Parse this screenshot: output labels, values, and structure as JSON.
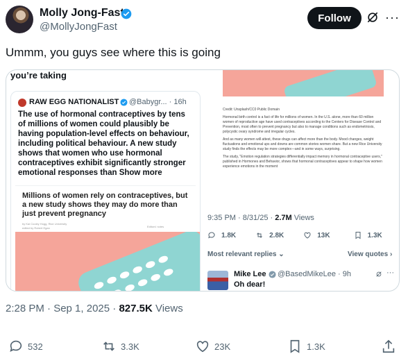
{
  "header": {
    "display_name": "Molly Jong-Fast",
    "handle": "@MollyJongFast",
    "follow_label": "Follow",
    "more_label": "···"
  },
  "tweet": {
    "text": "Ummm, you guys see where this is going",
    "timestamp": "2:28 PM · Sep 1, 2025 · ",
    "views": "827.5K",
    "views_label": " Views"
  },
  "media": {
    "top_text": "you’re taking",
    "quoted": {
      "name": "RAW EGG NATIONALIST",
      "handle": "@Babygr... · 16h",
      "text": "The use of hormonal contraceptives by tens of millions of women could plausibly be having population-level effects on behaviour, including political behaviour. A new study shows that women who use hormonal contraceptives exhibit significantly stronger emotional responses than Show more",
      "article_title": "Millions of women rely on contraceptives, but a new study shows they may do more than just prevent pregnancy",
      "byline": "by Kai Cooley Hogg, Rice University",
      "edited": "edited by Robert Egan",
      "share": "Editors' notes"
    },
    "article": {
      "credit": "Credit: Unsplash/CC0 Public Domain",
      "p1": "Hormonal birth control is a fact of life for millions of women. In the U.S. alone, more than 60 million women of reproductive age have used contraceptives according to the Centers for Disease Control and Prevention, most often to prevent pregnancy but also to manage conditions such as endometriosis, polycystic ovary syndrome and irregular cycles.",
      "p2": "And as many women will attest, these drugs can affect more than the body. Mood changes, weight fluctuations and emotional ups and downs are common stories women share. But a new Rice University study finds the effects may be more complex—and in some ways, surprising.",
      "p3": "The study, \"Emotion regulation strategies differentially impact memory in hormonal contraceptive users,\" published in Hormones and Behavior, shows that hormonal contraceptives appear to shape how women experience emotions in the moment"
    },
    "embedded_meta": {
      "time": "9:35 PM · 8/31/25 · ",
      "views": "2.7M",
      "views_label": " Views",
      "replies": "1.8K",
      "reposts": "2.8K",
      "likes": "13K",
      "bookmarks": "1.3K",
      "most_relevant": "Most relevant replies ⌄",
      "view_quotes": "View quotes ›"
    },
    "reply": {
      "name": "Mike Lee",
      "handle": "@BasedMikeLee · 9h",
      "text": "Oh dear!"
    }
  },
  "actions": {
    "replies": "532",
    "reposts": "3.3K",
    "likes": "23K",
    "bookmarks": "1.3K"
  }
}
